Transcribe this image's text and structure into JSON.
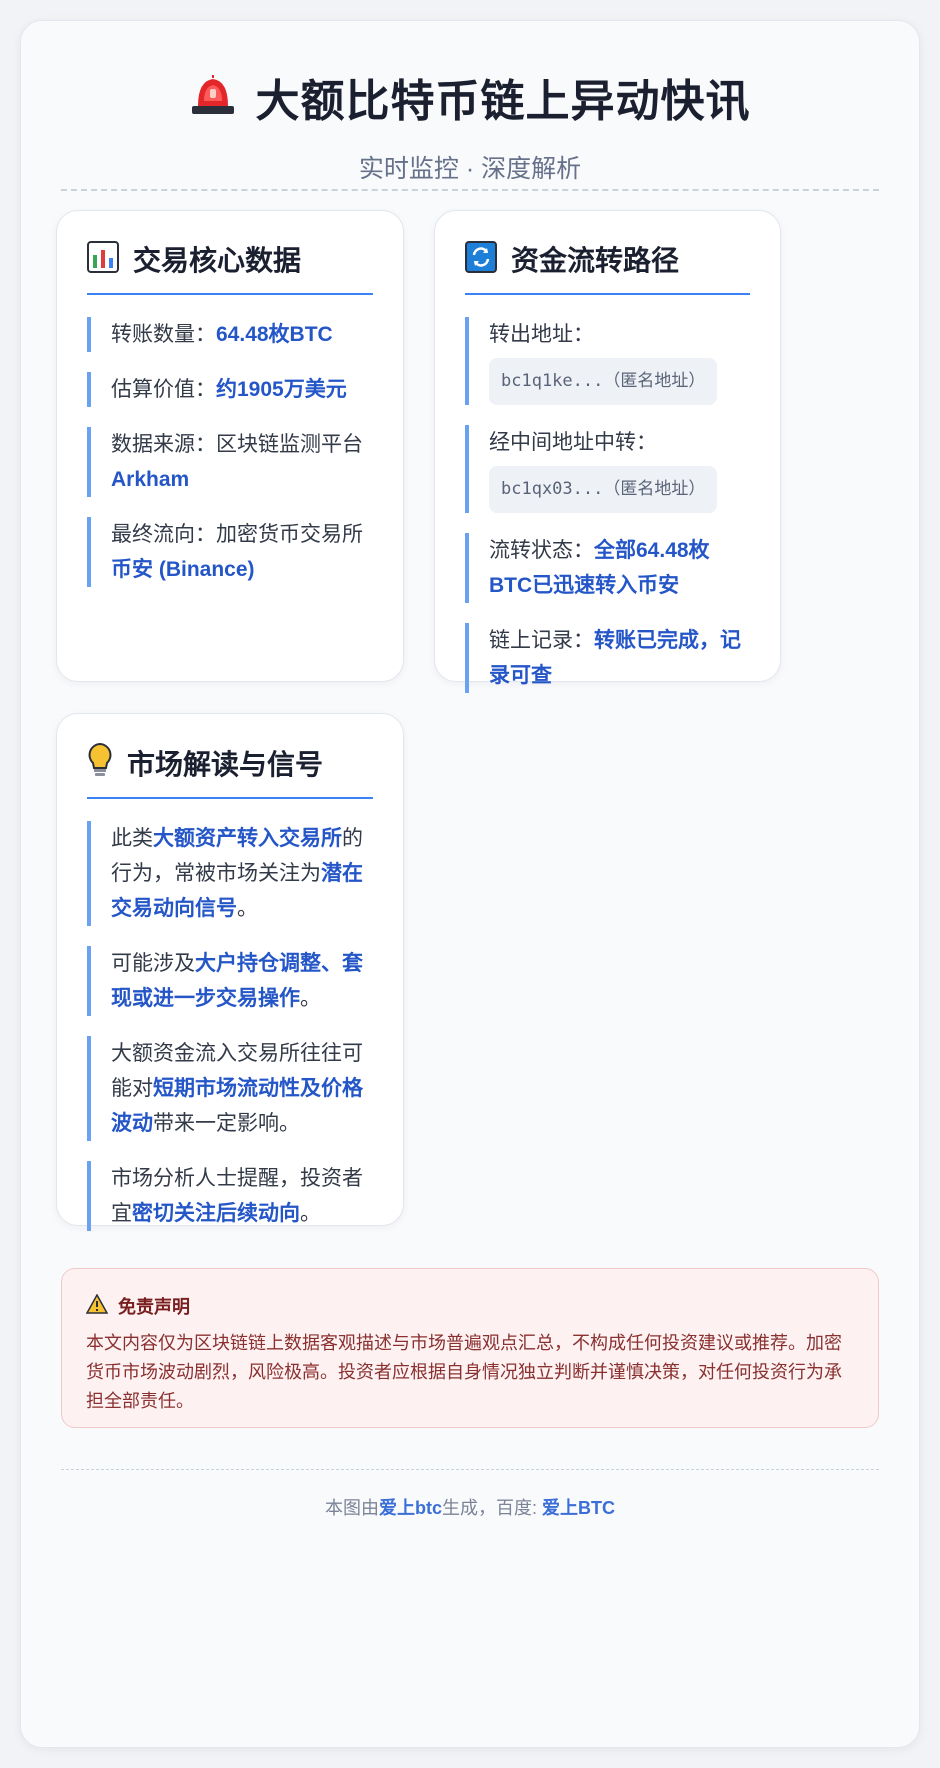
{
  "header": {
    "title": "大额比特币链上异动快讯",
    "subtitle": "实时监控 · 深度解析",
    "icon": "siren-icon"
  },
  "card_data": {
    "title": "交易核心数据",
    "icon": "bar-chart-icon",
    "items": [
      {
        "label": "转账数量：",
        "value": "64.48枚BTC"
      },
      {
        "label": "估算价值：",
        "value": "约1905万美元"
      },
      {
        "label": "数据来源：区块链监测平台",
        "value": "Arkham"
      },
      {
        "label": "最终流向：加密货币交易所",
        "value": "币安 (Binance)"
      }
    ]
  },
  "card_flow": {
    "title": "资金流转路径",
    "icon": "refresh-icon",
    "out_label": "转出地址：",
    "out_addr": "bc1q1ke...（匿名地址）",
    "mid_label": "经中间地址中转：",
    "mid_addr": "bc1qx03...（匿名地址）",
    "status_label": "流转状态：",
    "status_value": "全部64.48枚BTC已迅速转入币安",
    "record_label": "链上记录：",
    "record_value": "转账已完成，记录可查"
  },
  "card_market": {
    "title": "市场解读与信号",
    "icon": "lightbulb-icon",
    "p1": {
      "a": "此类",
      "b": "大额资产转入交易所",
      "c": "的行为，常被市场关注为",
      "d": "潜在交易动向信号",
      "e": "。"
    },
    "p2": {
      "a": "可能涉及",
      "b": "大户持仓调整、套现或进一步交易操作",
      "c": "。"
    },
    "p3": {
      "a": "大额资金流入交易所往往可能对",
      "b": "短期市场流动性及价格波动",
      "c": "带来一定影响。"
    },
    "p4": {
      "a": "市场分析人士提醒，投资者宜",
      "b": "密切关注后续动向",
      "c": "。"
    }
  },
  "disclaimer": {
    "icon": "warning-icon",
    "title": "免责声明",
    "text": "本文内容仅为区块链链上数据客观描述与市场普遍观点汇总，不构成任何投资建议或推荐。加密货币市场波动剧烈，风险极高。投资者应根据自身情况独立判断并谨慎决策，对任何投资行为承担全部责任。"
  },
  "footer": {
    "prefix": "本图由",
    "brand1": "爱上btc",
    "middle": "生成，百度: ",
    "brand2": "爱上BTC"
  },
  "colors": {
    "accent": "#3b82f6",
    "highlight": "#2456c8",
    "warning_bg": "#fdf1f1"
  }
}
